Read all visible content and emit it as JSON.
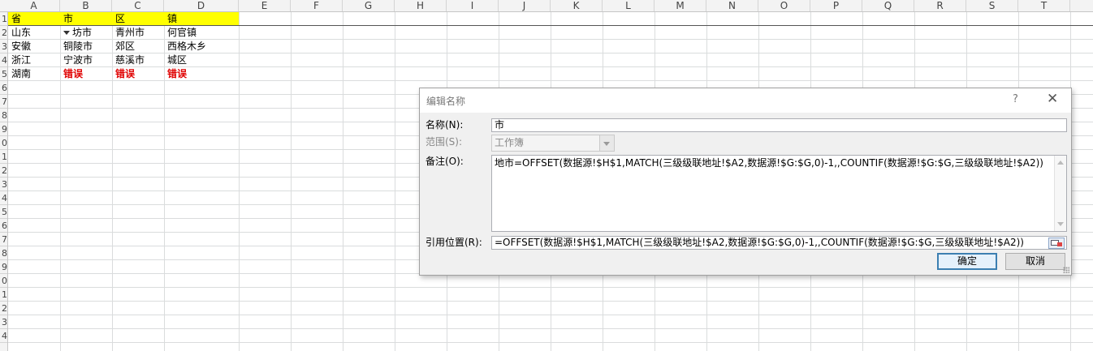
{
  "columns": [
    "A",
    "B",
    "C",
    "D",
    "E",
    "F",
    "G",
    "H",
    "I",
    "J",
    "K",
    "L",
    "M",
    "N",
    "O",
    "P",
    "Q",
    "R",
    "S",
    "T"
  ],
  "row_numbers": [
    "1",
    "2",
    "3",
    "4",
    "5",
    "6",
    "7",
    "8",
    "9",
    "0",
    "1",
    "2",
    "3",
    "4",
    "5",
    "6",
    "7",
    "8",
    "9",
    "0",
    "1",
    "2",
    "3",
    "4"
  ],
  "cells": {
    "header": [
      "省",
      "市",
      "区",
      "镇"
    ],
    "row2": [
      "山东",
      "坊市",
      "青州市",
      "何官镇"
    ],
    "row3": [
      "安徽",
      "铜陵市",
      "郊区",
      "西格木乡"
    ],
    "row4": [
      "浙江",
      "宁波市",
      "慈溪市",
      "城区"
    ],
    "row5": [
      "湖南",
      "错误",
      "错误",
      "错误"
    ]
  },
  "colors": {
    "header_fill": "#ffff00",
    "error_text": "#e00000",
    "ok_border": "#3c7fb1"
  },
  "dialog": {
    "title": "编辑名称",
    "help": "?",
    "close": "✕",
    "name_label": "名称(N):",
    "name_value": "市",
    "scope_label": "范围(S):",
    "scope_value": "工作簿",
    "comment_label": "备注(O):",
    "comment_value": "地市=OFFSET(数据源!$H$1,MATCH(三级级联地址!$A2,数据源!$G:$G,0)-1,,COUNTIF(数据源!$G:$G,三级级联地址!$A2))",
    "ref_label": "引用位置(R):",
    "ref_value": "=OFFSET(数据源!$H$1,MATCH(三级级联地址!$A2,数据源!$G:$G,0)-1,,COUNTIF(数据源!$G:$G,三级级联地址!$A2))",
    "ok": "确定",
    "cancel": "取消"
  }
}
